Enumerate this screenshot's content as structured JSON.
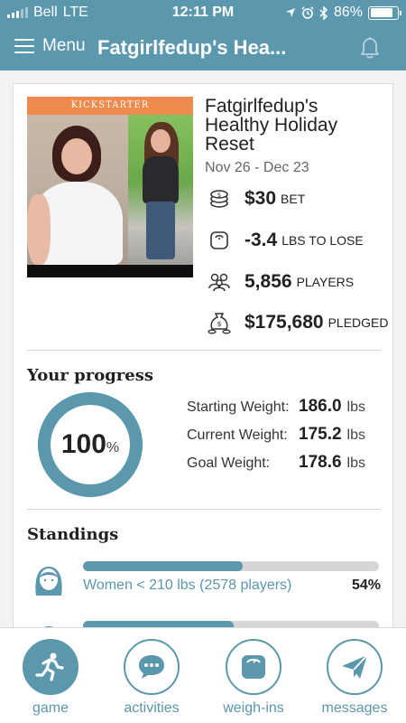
{
  "status_bar": {
    "carrier": "Bell",
    "network": "LTE",
    "time": "12:11 PM",
    "battery": "86%",
    "battery_level": 0.86
  },
  "nav": {
    "menu_label": "Menu",
    "title": "Fatgirlfedup's Hea...",
    "icon_menu": "hamburger-icon",
    "icon_bell": "bell-icon"
  },
  "challenge": {
    "banner": "KICKSTARTER",
    "title": "Fatgirlfedup's Healthy Holiday Reset",
    "dates": "Nov 26 - Dec 23",
    "stats": [
      {
        "icon": "coins-icon",
        "value": "$30",
        "unit": "BET"
      },
      {
        "icon": "scale-icon",
        "value": "-3.4",
        "unit": "LBS TO LOSE"
      },
      {
        "icon": "players-icon",
        "value": "5,856",
        "unit": "PLAYERS"
      },
      {
        "icon": "money-bag-icon",
        "value": "$175,680",
        "unit": "PLEDGED"
      }
    ]
  },
  "progress": {
    "heading": "Your progress",
    "percent": "100",
    "percent_symbol": "%",
    "percent_value": 100,
    "rows": [
      {
        "label": "Starting Weight:",
        "value": "186.0",
        "unit": "lbs"
      },
      {
        "label": "Current Weight:",
        "value": "175.2",
        "unit": "lbs"
      },
      {
        "label": "Goal Weight:",
        "value": "178.6",
        "unit": "lbs"
      }
    ]
  },
  "standings": {
    "heading": "Standings",
    "items": [
      {
        "label": "Women < 210 lbs (2578 players)",
        "percent": "54%",
        "fill": 0.54
      },
      {
        "label": "",
        "percent": "",
        "fill": 0.51
      }
    ]
  },
  "tabs": [
    {
      "label": "game",
      "icon": "runner-icon",
      "active": true
    },
    {
      "label": "activities",
      "icon": "chat-bubble-icon",
      "active": false
    },
    {
      "label": "weigh-ins",
      "icon": "scale-icon",
      "active": false
    },
    {
      "label": "messages",
      "icon": "paper-plane-icon",
      "active": false
    }
  ],
  "colors": {
    "brand": "#5b97ad",
    "banner": "#ee8a4d",
    "background": "#f2f2f2"
  }
}
